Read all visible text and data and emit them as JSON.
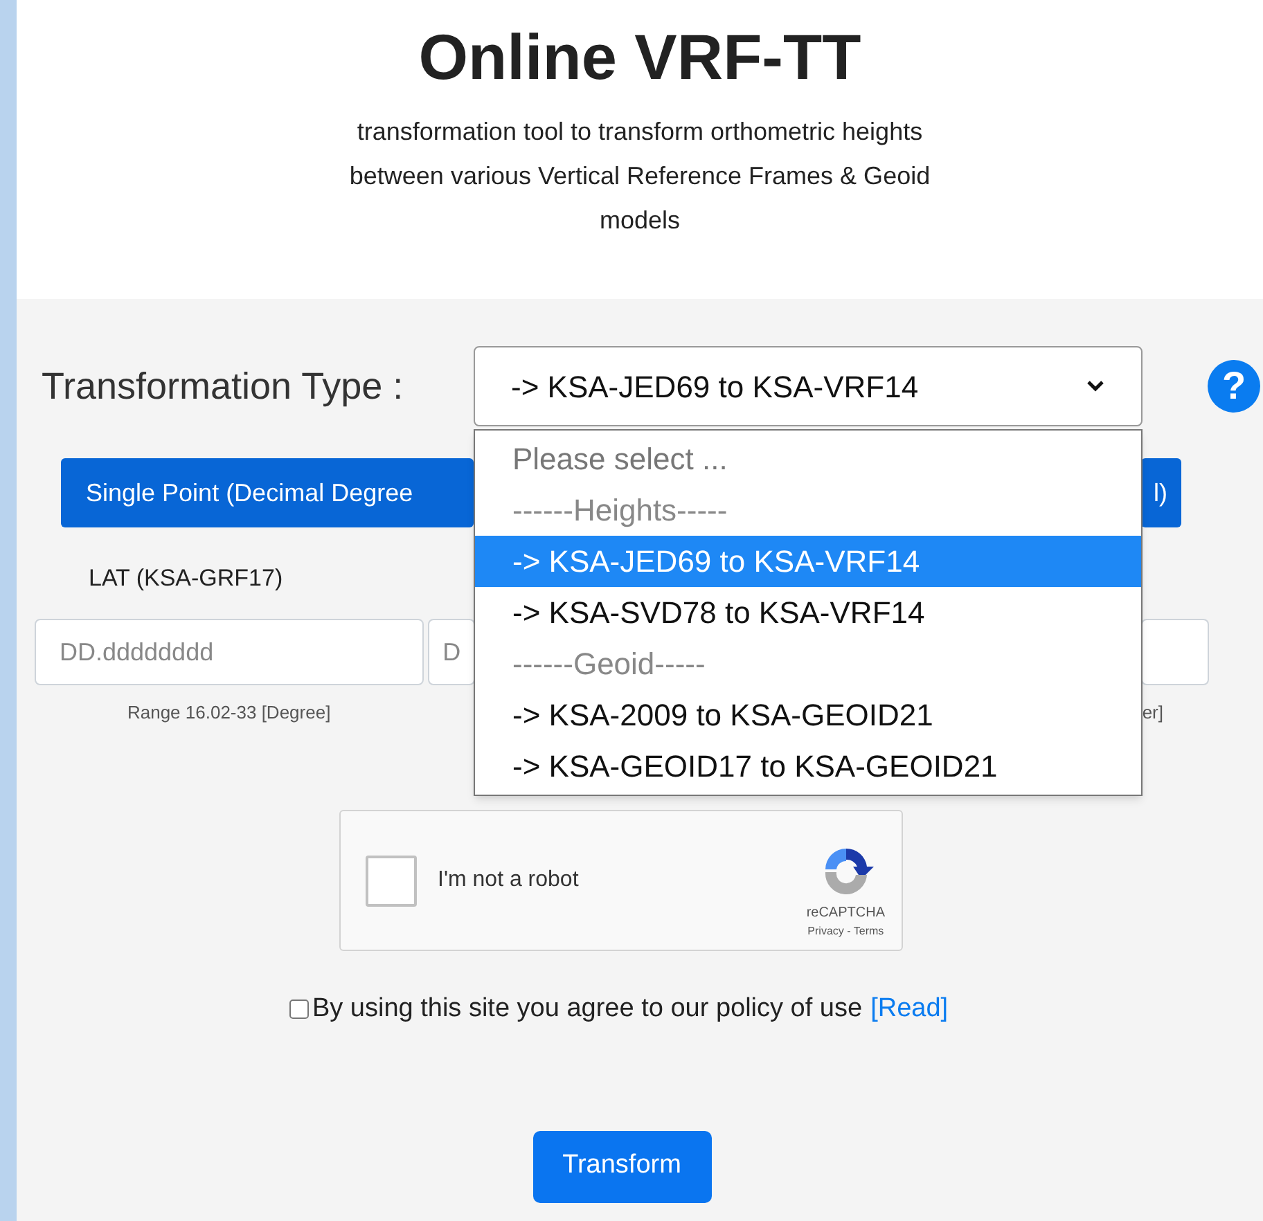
{
  "header": {
    "title": "Online VRF-TT",
    "subtitle": "transformation tool to transform orthometric heights between various Vertical Reference Frames & Geoid models"
  },
  "transformation": {
    "label": "Transformation Type :",
    "value": "-> KSA-JED69 to KSA-VRF14",
    "help": "?"
  },
  "dropdown": {
    "options": [
      {
        "kind": "placeholder",
        "label": "Please select ...",
        "selected": false
      },
      {
        "kind": "group",
        "label": "------Heights-----",
        "selected": false
      },
      {
        "kind": "option",
        "label": "-> KSA-JED69 to KSA-VRF14",
        "selected": true
      },
      {
        "kind": "option",
        "label": "-> KSA-SVD78 to KSA-VRF14",
        "selected": false
      },
      {
        "kind": "group",
        "label": "------Geoid-----",
        "selected": false
      },
      {
        "kind": "option",
        "label": "-> KSA-2009 to KSA-GEOID21",
        "selected": false
      },
      {
        "kind": "option",
        "label": "-> KSA-GEOID17 to KSA-GEOID21",
        "selected": false
      }
    ]
  },
  "mode_buttons": [
    {
      "label": "Single Point (Decimal Degree"
    },
    {
      "label": "l)"
    }
  ],
  "fields": [
    {
      "label": "LAT (KSA-GRF17)",
      "placeholder": "DD.dddddddd",
      "hint": "Range 16.02-33 [Degree]"
    },
    {
      "placeholder": "D"
    },
    {
      "hint": "er]"
    }
  ],
  "captcha": {
    "label": "I'm not a robot",
    "checked": false,
    "brand": "reCAPTCHA",
    "links": "Privacy - Terms"
  },
  "policy": {
    "checked": false,
    "text": "By using this site you agree to our policy of use",
    "link": "[Read]"
  },
  "submit": "Transform"
}
